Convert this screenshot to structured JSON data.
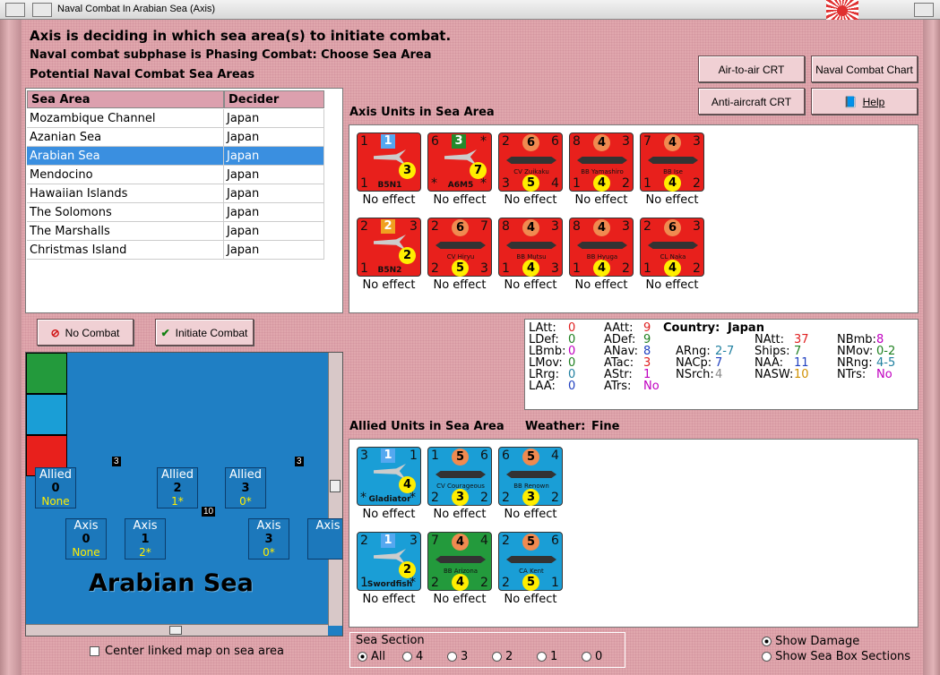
{
  "window": {
    "title": "Naval Combat In Arabian Sea (Axis)"
  },
  "status": {
    "line1": "Axis is deciding in which sea area(s) to initiate combat.",
    "line2": "Naval combat subphase is Phasing Combat: Choose Sea Area",
    "line3": "Potential Naval Combat Sea Areas"
  },
  "buttons": {
    "air_to_air": "Air-to-air CRT",
    "naval_chart": "Naval Combat Chart",
    "anti_aircraft": "Anti-aircraft CRT",
    "help": "Help",
    "no_combat": "No Combat",
    "initiate": "Initiate Combat"
  },
  "table": {
    "headers": [
      "Sea Area",
      "Decider"
    ],
    "rows": [
      {
        "area": "Mozambique Channel",
        "decider": "Japan"
      },
      {
        "area": "Azanian Sea",
        "decider": "Japan"
      },
      {
        "area": "Arabian Sea",
        "decider": "Japan",
        "selected": true
      },
      {
        "area": "Mendocino",
        "decider": "Japan"
      },
      {
        "area": "Hawaiian Islands",
        "decider": "Japan"
      },
      {
        "area": "The Solomons",
        "decider": "Japan"
      },
      {
        "area": "The Marshalls",
        "decider": "Japan"
      },
      {
        "area": "Christmas Island",
        "decider": "Japan"
      }
    ]
  },
  "axis_units": {
    "label": "Axis Units in Sea Area",
    "units": [
      {
        "name": "B5N1",
        "tl": "1",
        "tc": "1",
        "tr": "",
        "bl": "1",
        "br": "",
        "c1": "3",
        "effect": "No effect",
        "kind": "plane"
      },
      {
        "name": "A6M5",
        "tl": "6",
        "tc": "3",
        "tr": "*",
        "bl": "*",
        "br": "*",
        "c1": "7",
        "effect": "No effect",
        "kind": "plane"
      },
      {
        "name": "CV Zuikaku",
        "tl": "2",
        "tc": "6",
        "tr": "6",
        "bl": "3",
        "br": "4",
        "c1": "5",
        "effect": "No effect",
        "kind": "ship"
      },
      {
        "name": "BB Yamashiro",
        "tl": "8",
        "tc": "4",
        "tr": "3",
        "bl": "1",
        "br": "2",
        "c1": "4",
        "effect": "No effect",
        "kind": "ship"
      },
      {
        "name": "BB Ise",
        "tl": "7",
        "tc": "4",
        "tr": "3",
        "bl": "1",
        "br": "2",
        "c1": "4",
        "effect": "No effect",
        "kind": "ship"
      },
      {
        "name": "B5N2",
        "tl": "2",
        "tc": "2",
        "tr": "3",
        "bl": "1",
        "br": "",
        "c1": "2",
        "effect": "No effect",
        "kind": "plane"
      },
      {
        "name": "CV Hiryu",
        "tl": "2",
        "tc": "6",
        "tr": "7",
        "bl": "2",
        "br": "3",
        "c1": "5",
        "effect": "No effect",
        "kind": "ship"
      },
      {
        "name": "BB Mutsu",
        "tl": "8",
        "tc": "4",
        "tr": "3",
        "bl": "1",
        "br": "3",
        "c1": "4",
        "effect": "No effect",
        "kind": "ship"
      },
      {
        "name": "BB Hyuga",
        "tl": "8",
        "tc": "4",
        "tr": "3",
        "bl": "1",
        "br": "2",
        "c1": "4",
        "effect": "No effect",
        "kind": "ship"
      },
      {
        "name": "CL Naka",
        "tl": "2",
        "tc": "6",
        "tr": "3",
        "bl": "1",
        "br": "2",
        "c1": "4",
        "effect": "No effect",
        "kind": "ship"
      }
    ]
  },
  "stats": {
    "country_label": "Country:",
    "country": "Japan",
    "items": [
      {
        "k": "LAtt:",
        "v": "0",
        "c": "#e02020"
      },
      {
        "k": "LDef:",
        "v": "0",
        "c": "#208020"
      },
      {
        "k": "LBmb:",
        "v": "0",
        "c": "#c000c0"
      },
      {
        "k": "LMov:",
        "v": "0",
        "c": "#208020"
      },
      {
        "k": "LRrg:",
        "v": "0",
        "c": "#2080a0"
      },
      {
        "k": "LAA:",
        "v": "0",
        "c": "#2040c0"
      },
      {
        "k": "AAtt:",
        "v": "9",
        "c": "#e02020"
      },
      {
        "k": "ADef:",
        "v": "9",
        "c": "#208020"
      },
      {
        "k": "ANav:",
        "v": "8",
        "c": "#2040c0"
      },
      {
        "k": "ATac:",
        "v": "3",
        "c": "#e02020"
      },
      {
        "k": "AStr:",
        "v": "1",
        "c": "#c000c0"
      },
      {
        "k": "ATrs:",
        "v": "No",
        "c": "#c000c0"
      },
      {
        "k": "ARng:",
        "v": "2-7",
        "c": "#2080a0"
      },
      {
        "k": "NACp:",
        "v": "7",
        "c": "#2040c0"
      },
      {
        "k": "NSrch:",
        "v": "4",
        "c": "#888888"
      },
      {
        "k": "NAtt:",
        "v": "37",
        "c": "#e02020"
      },
      {
        "k": "Ships:",
        "v": "7",
        "c": "#208020"
      },
      {
        "k": "NAA:",
        "v": "11",
        "c": "#2040c0"
      },
      {
        "k": "NASW:",
        "v": "10",
        "c": "#d09000"
      },
      {
        "k": "NBmb:",
        "v": "8",
        "c": "#c000c0"
      },
      {
        "k": "NMov:",
        "v": "0-2",
        "c": "#208020"
      },
      {
        "k": "NRng:",
        "v": "4-5",
        "c": "#2080a0"
      },
      {
        "k": "NTrs:",
        "v": "No",
        "c": "#c000c0"
      }
    ]
  },
  "allied_units": {
    "label": "Allied Units in Sea Area",
    "weather_label": "Weather:",
    "weather": "Fine",
    "units": [
      {
        "name": "Gladiator",
        "tl": "3",
        "tc": "1",
        "tr": "1",
        "bl": "*",
        "br": "*",
        "c1": "4",
        "effect": "No effect",
        "kind": "plane",
        "color": "blue"
      },
      {
        "name": "CV Courageous",
        "tl": "1",
        "tc": "5",
        "tr": "6",
        "bl": "2",
        "br": "2",
        "c1": "3",
        "effect": "No effect",
        "kind": "ship",
        "color": "blue"
      },
      {
        "name": "BB Renown",
        "tl": "6",
        "tc": "5",
        "tr": "4",
        "bl": "2",
        "br": "2",
        "c1": "3",
        "effect": "No effect",
        "kind": "ship",
        "color": "blue"
      },
      {
        "name": "Swordfish",
        "tl": "2",
        "tc": "1",
        "tr": "3",
        "bl": "1",
        "br": "*",
        "c1": "2",
        "effect": "No effect",
        "kind": "plane",
        "color": "blue"
      },
      {
        "name": "BB Arizona",
        "tl": "7",
        "tc": "4",
        "tr": "4",
        "bl": "2",
        "br": "2",
        "c1": "4",
        "effect": "No effect",
        "kind": "ship",
        "color": "green"
      },
      {
        "name": "CA Kent",
        "tl": "2",
        "tc": "5",
        "tr": "6",
        "bl": "2",
        "br": "1",
        "c1": "5",
        "effect": "No effect",
        "kind": "ship",
        "color": "blue"
      }
    ]
  },
  "map": {
    "area_name": "Arabian Sea",
    "allied_boxes": [
      {
        "t": "Allied",
        "n": "0",
        "s": "None"
      },
      {
        "t": "Allied",
        "n": "2",
        "s": "1*"
      },
      {
        "t": "Allied",
        "n": "3",
        "s": "0*"
      }
    ],
    "axis_boxes": [
      {
        "t": "Axis",
        "n": "0",
        "s": "None"
      },
      {
        "t": "Axis",
        "n": "1",
        "s": "2*"
      },
      {
        "t": "Axis",
        "n": "3",
        "s": "0*"
      },
      {
        "t": "Axis",
        "n": "",
        "s": ""
      }
    ],
    "stack_counts": {
      "arizona": "3",
      "swordfish": "3",
      "axis_stack": "10"
    },
    "center_label": "Center linked map on sea area"
  },
  "sea_section": {
    "label": "Sea Section",
    "options": [
      "All",
      "4",
      "3",
      "2",
      "1",
      "0"
    ],
    "selected": "All"
  },
  "toggles": {
    "show_damage": "Show Damage",
    "show_sections": "Show Sea Box Sections"
  }
}
